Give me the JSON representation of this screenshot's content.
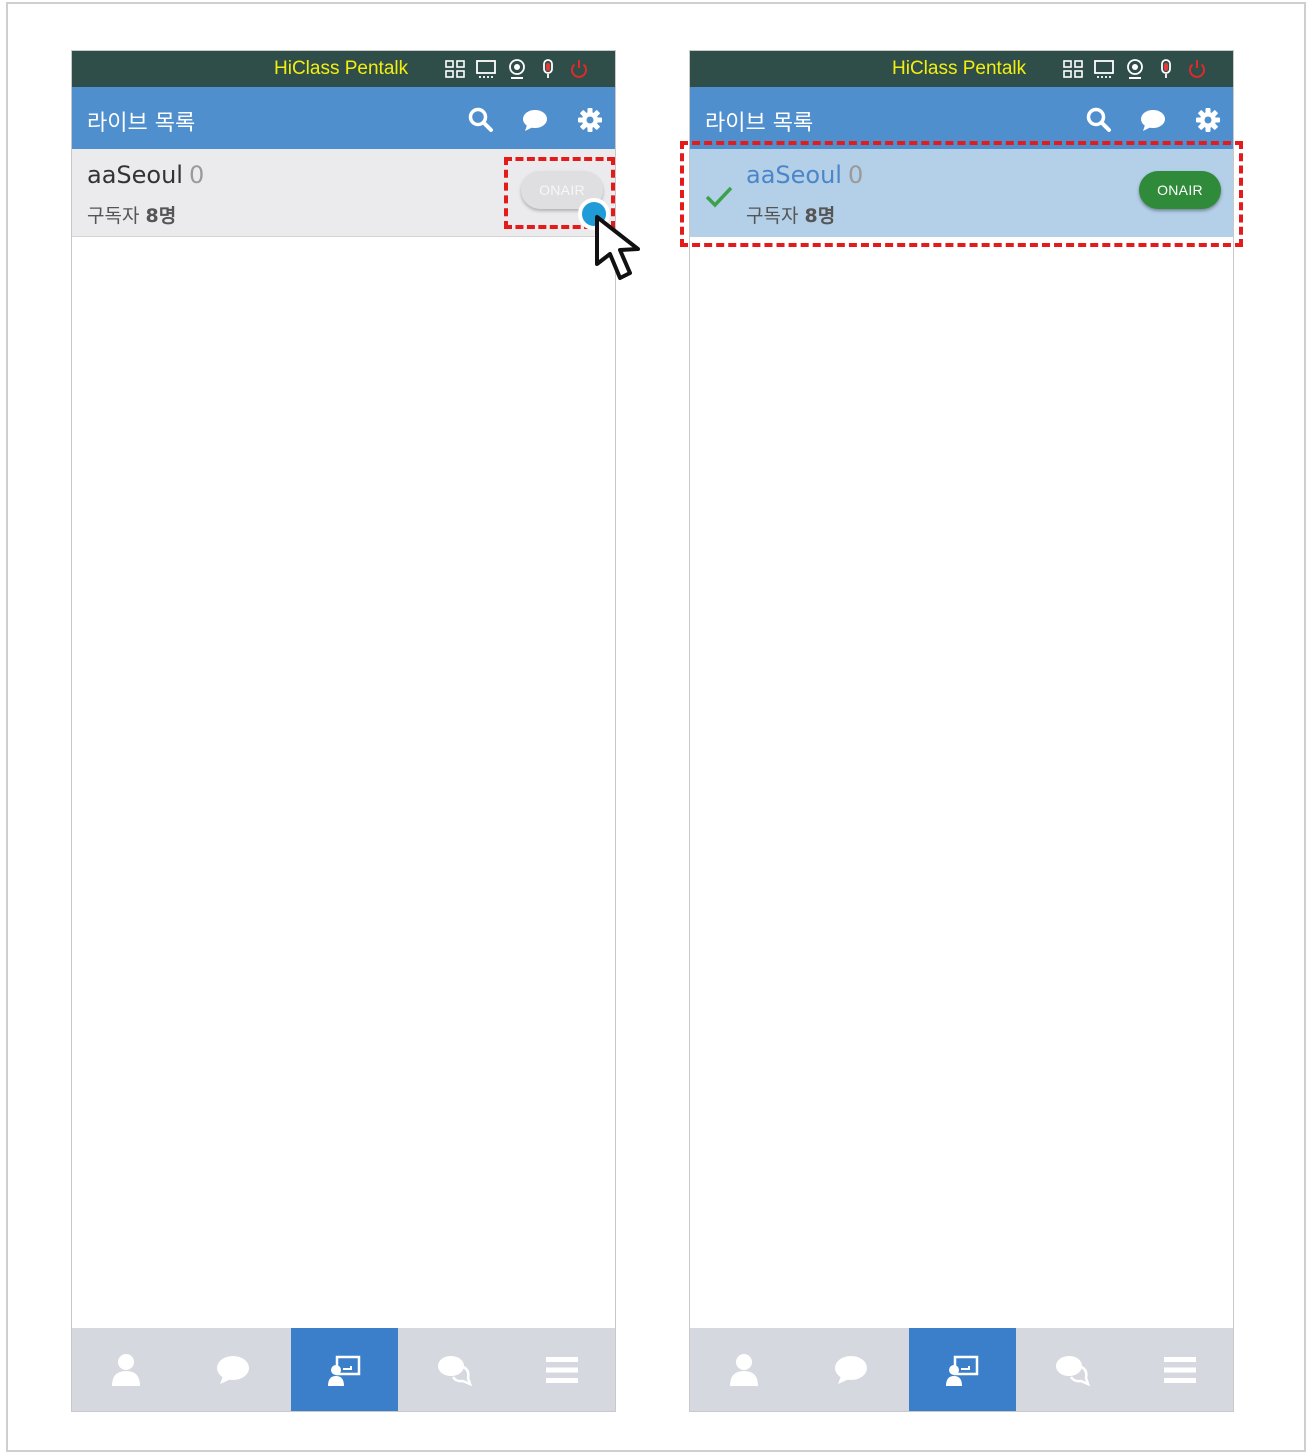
{
  "app": {
    "title": "HiClass Pentalk"
  },
  "header": {
    "title": "라이브 목록"
  },
  "left_panel": {
    "item": {
      "name": "aaSeoul",
      "count": "0",
      "subscribers_label": "구독자",
      "subscribers_value": "8명",
      "button": "ONAIR",
      "state": "off"
    }
  },
  "right_panel": {
    "item": {
      "name": "aaSeoul",
      "count": "0",
      "subscribers_label": "구독자",
      "subscribers_value": "8명",
      "button": "ONAIR",
      "state": "on"
    }
  },
  "tabs": [
    "user-icon",
    "chat-icon",
    "live-class-icon",
    "discussion-icon",
    "menu-icon"
  ],
  "active_tab": 2,
  "colors": {
    "titlebar": "#2f4e49",
    "app_title": "#f4ee10",
    "header": "#4f8fce",
    "selected_row": "#b4cfe8",
    "onair_on": "#2f8a39",
    "onair_off": "#dfdfe1",
    "tab_active": "#3b7fca",
    "tabbar": "#d5d8df",
    "highlight": "#e31b1b"
  }
}
